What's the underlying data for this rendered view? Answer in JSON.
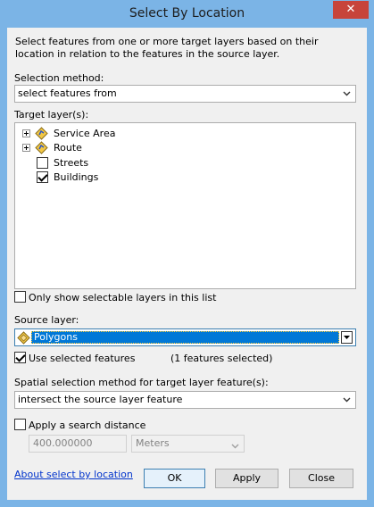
{
  "window": {
    "title": "Select By Location",
    "close_glyph": "✕"
  },
  "description": "Select features from one or more target layers based on their location in relation to the features in the source layer.",
  "selection_method": {
    "label": "Selection method:",
    "value": "select features from"
  },
  "target_layers": {
    "label": "Target layer(s):",
    "items": [
      {
        "label": "Service Area",
        "type": "network-group",
        "expandable": true,
        "checked": false
      },
      {
        "label": "Route",
        "type": "network-group",
        "expandable": true,
        "checked": false
      },
      {
        "label": "Streets",
        "type": "layer",
        "expandable": false,
        "checked": false
      },
      {
        "label": "Buildings",
        "type": "layer",
        "expandable": false,
        "checked": true
      }
    ]
  },
  "only_selectable": {
    "label": "Only show selectable layers in this list",
    "checked": false
  },
  "source_layer": {
    "label": "Source layer:",
    "value": "Polygons"
  },
  "use_selected": {
    "label": "Use selected features",
    "checked": true,
    "count_text": "(1 features selected)"
  },
  "spatial_method": {
    "label": "Spatial selection method for target layer feature(s):",
    "value": "intersect the source layer feature"
  },
  "search_distance": {
    "label": "Apply a search distance",
    "checked": false,
    "value": "400.000000",
    "units": "Meters"
  },
  "footer": {
    "help_link": "About select by location",
    "ok_label": "OK",
    "apply_label": "Apply",
    "close_label": "Close"
  },
  "colors": {
    "title_bar": "#7bb4e6",
    "close_button": "#c7443b",
    "selection_highlight": "#0078d7",
    "link": "#0033cc"
  }
}
